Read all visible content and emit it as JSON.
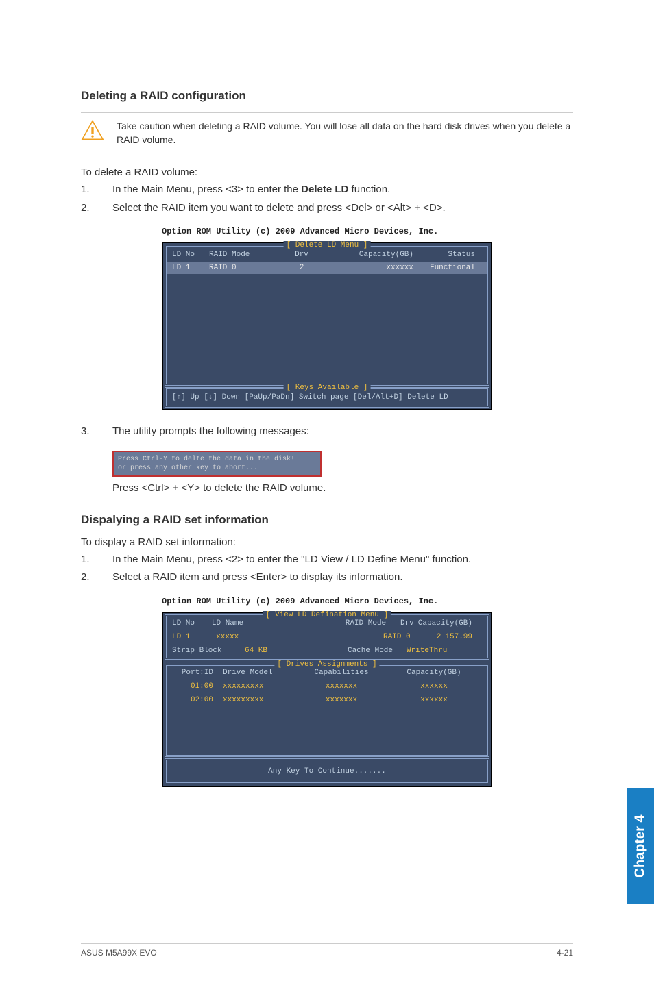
{
  "section1_title": "Deleting a RAID configuration",
  "caution_text": "Take caution when deleting a RAID volume. You will lose all data on the hard disk drives when you delete a RAID volume.",
  "intro1": "To delete a RAID volume:",
  "steps1": [
    {
      "pre": "In the Main Menu, press <3> to enter the ",
      "bold": "Delete LD",
      "post": " function."
    },
    {
      "pre": "Select the RAID item you want to delete and press <Del> or <Alt> + <D>.",
      "bold": "",
      "post": ""
    }
  ],
  "term_caption": "Option ROM Utility (c) 2009 Advanced Micro Devices, Inc.",
  "term1": {
    "title": "[ Delete LD Menu ]",
    "headers": {
      "ldno": "LD No",
      "mode": "RAID Mode",
      "drv": "Drv",
      "cap": "Capacity(GB)",
      "status": "Status"
    },
    "row": {
      "ldno": "LD  1",
      "mode": "RAID 0",
      "drv": "2",
      "cap": "xxxxxx",
      "status": "Functional"
    },
    "footer_title": "[ Keys Available ]",
    "footer": "[↑] Up  [↓] Down  [PaUp/PaDn] Switch page  [Del/Alt+D] Delete LD"
  },
  "step3_label": "3.",
  "step3_text": "The utility prompts the following messages:",
  "red_box_line1": "Press Ctrl-Y to delte the data in the disk!",
  "red_box_line2": "or press any other key to abort...",
  "post_red_text": "Press <Ctrl> + <Y> to delete the RAID volume.",
  "section2_title": "Dispalying a RAID set information",
  "intro2": "To display a RAID set information:",
  "steps2": [
    "In the Main Menu, press <2> to enter the \"LD View / LD Define Menu\" function.",
    "Select a RAID item and press <Enter> to display its information."
  ],
  "term2": {
    "title": "[ View LD Defination Menu ]",
    "r1": {
      "a": "LD No",
      "b": "LD Name",
      "d": "RAID Mode",
      "e": "Drv",
      "f": "Capacity(GB)"
    },
    "r2": {
      "a": "LD  1",
      "b": "xxxxx",
      "d": "RAID 0",
      "e": "2",
      "f": "157.99"
    },
    "r3": {
      "a_lbl": "Strip Block",
      "a_val": "64 KB",
      "b_lbl": "Cache Mode",
      "b_val": "WriteThru"
    },
    "sub_title": "[ Drives Assignments ]",
    "dh": {
      "a": "Port:ID",
      "b": "Drive Model",
      "c": "Capabilities",
      "d": "Capacity(GB)"
    },
    "d1": {
      "a": "01:00",
      "b": "xxxxxxxxx",
      "c": "xxxxxxx",
      "d": "xxxxxx"
    },
    "d2": {
      "a": "02:00",
      "b": "xxxxxxxxx",
      "c": "xxxxxxx",
      "d": "xxxxxx"
    },
    "continue": "Any Key To Continue......."
  },
  "side_tab": "Chapter 4",
  "footer_left": "ASUS M5A99X EVO",
  "footer_right": "4-21"
}
